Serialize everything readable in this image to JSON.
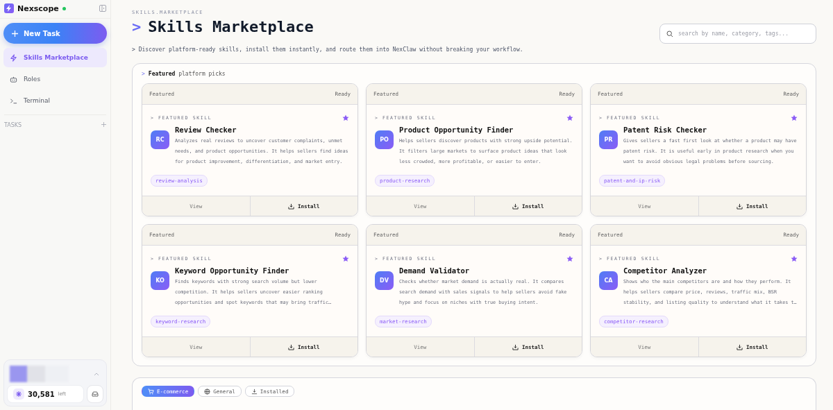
{
  "sidebar": {
    "brand": "Nexscope",
    "online": true,
    "new_task": "New Task",
    "items": [
      {
        "label": "Skills Marketplace",
        "selected": true
      },
      {
        "label": "Roles",
        "selected": false
      },
      {
        "label": "Terminal",
        "selected": false
      }
    ],
    "tasks_label": "TASKS",
    "credits": "30,581",
    "credits_unit": "left"
  },
  "header": {
    "breadcrumb": "SKILLS.MARKETPLACE",
    "prompt": ">",
    "title": "Skills Marketplace",
    "subtitle": "> Discover platform-ready skills, install them instantly, and route them into NexClaw without breaking your workflow.",
    "search_placeholder": "search by name, category, tags..."
  },
  "featured": {
    "prompt": ">",
    "heading": "**Featured** platform picks",
    "cards": [
      {
        "tag": "Featured",
        "status": "Ready",
        "eyebrow": "> FEATURED SKILL",
        "starred": true,
        "initials": "RC",
        "name": "Review Checker",
        "description": "Analyzes real reviews to uncover customer complaints, unmet needs, and product opportunities. It helps sellers find ideas for product improvement, differentiation, and market entry.",
        "label": "review-analysis",
        "view": "View",
        "install": "Install"
      },
      {
        "tag": "Featured",
        "status": "Ready",
        "eyebrow": "> FEATURED SKILL",
        "starred": true,
        "initials": "PO",
        "name": "Product Opportunity Finder",
        "description": "Helps sellers discover products with strong upside potential. It filters large markets to surface product ideas that look less crowded, more profitable, or easier to enter.",
        "label": "product-research",
        "view": "View",
        "install": "Install"
      },
      {
        "tag": "Featured",
        "status": "Ready",
        "eyebrow": "> FEATURED SKILL",
        "starred": true,
        "initials": "PR",
        "name": "Patent Risk Checker",
        "description": "Gives sellers a fast first look at whether a product may have patent risk. It is useful early in product research when you want to avoid obvious legal problems before sourcing.",
        "label": "patent-and-ip-risk",
        "view": "View",
        "install": "Install"
      },
      {
        "tag": "Featured",
        "status": "Ready",
        "eyebrow": "> FEATURED SKILL",
        "starred": true,
        "initials": "KO",
        "name": "Keyword Opportunity Finder",
        "description": "Finds keywords with strong search volume but lower competition. It helps sellers uncover easier ranking opportunities and spot keywords that may bring traffic…",
        "label": "keyword-research",
        "view": "View",
        "install": "Install"
      },
      {
        "tag": "Featured",
        "status": "Ready",
        "eyebrow": "> FEATURED SKILL",
        "starred": true,
        "initials": "DV",
        "name": "Demand Validator",
        "description": "Checks whether market demand is actually real. It compares search demand with sales signals to help sellers avoid fake hype and focus on niches with true buying intent.",
        "label": "market-research",
        "view": "View",
        "install": "Install"
      },
      {
        "tag": "Featured",
        "status": "Ready",
        "eyebrow": "> FEATURED SKILL",
        "starred": true,
        "initials": "CA",
        "name": "Competitor Analyzer",
        "description": "Shows who the main competitors are and how they perform. It helps sellers compare price, reviews, traffic mix, BSR stability, and listing quality to understand what it takes t…",
        "label": "competitor-research",
        "view": "View",
        "install": "Install"
      }
    ]
  },
  "category_tabs": [
    {
      "label": "E-commerce",
      "selected": true
    },
    {
      "label": "General",
      "selected": false
    },
    {
      "label": "Installed",
      "selected": false
    }
  ]
}
